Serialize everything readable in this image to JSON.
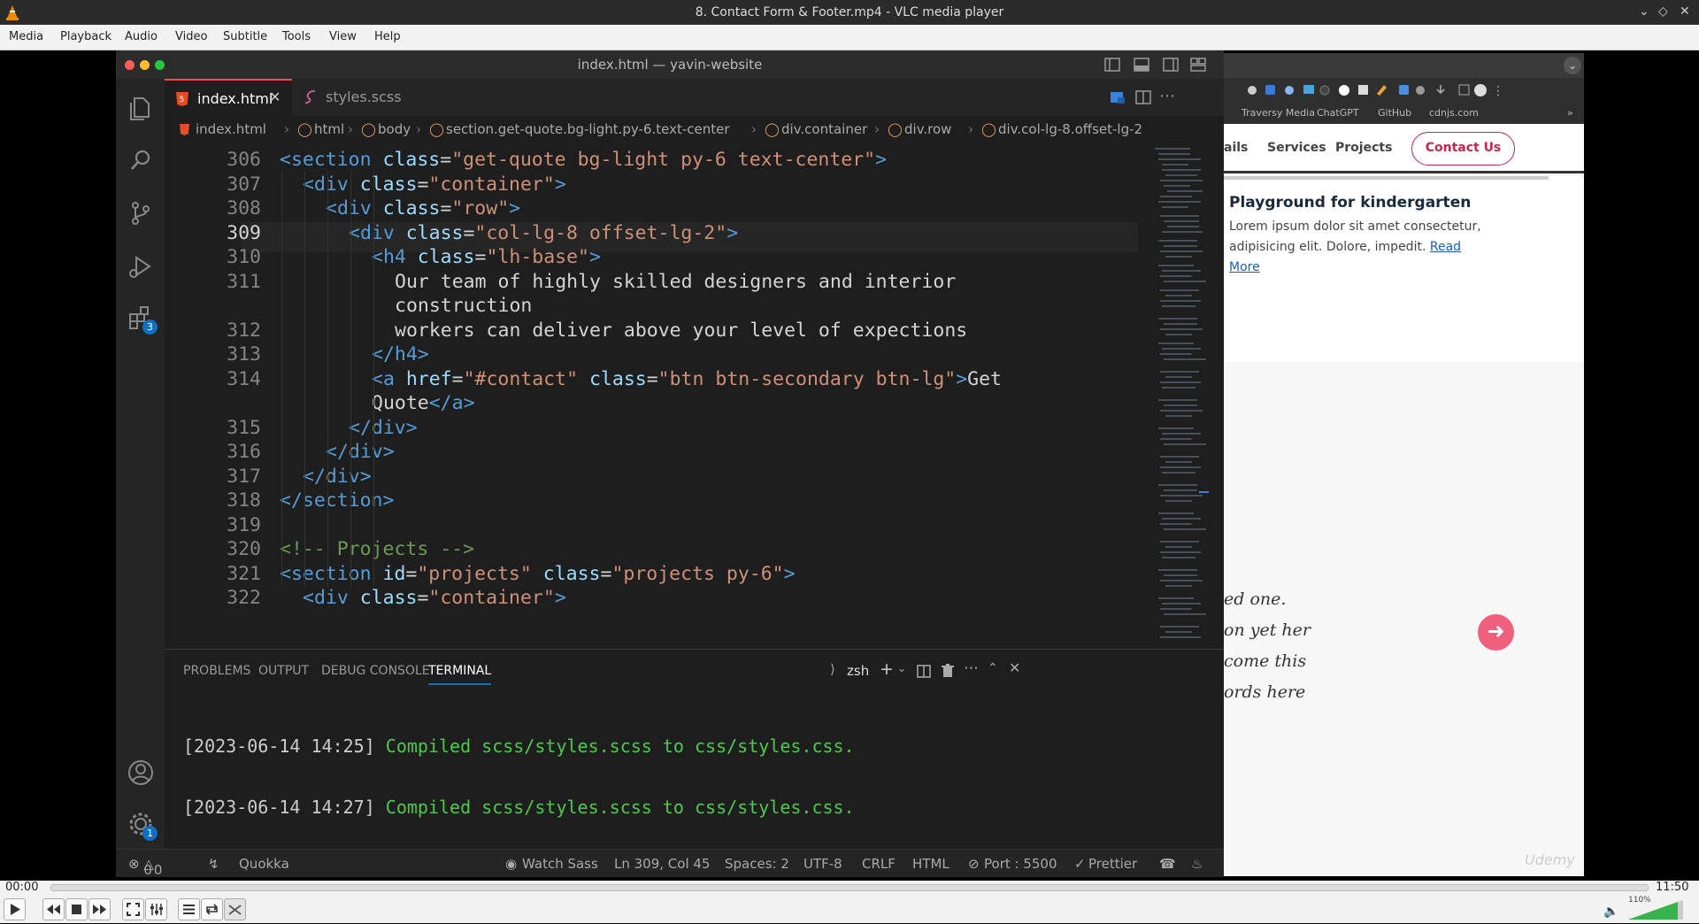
{
  "window": {
    "title": "8. Contact Form & Footer.mp4 - VLC media player"
  },
  "menu": [
    "Media",
    "Playback",
    "Audio",
    "Video",
    "Subtitle",
    "Tools",
    "View",
    "Help"
  ],
  "vscode": {
    "title": "index.html — yavin-website",
    "tabs": [
      {
        "label": "index.html",
        "active": true
      },
      {
        "label": "styles.scss",
        "active": false
      }
    ],
    "breadcrumb": [
      "index.html",
      "html",
      "body",
      "section.get-quote.bg-light.py-6.text-center",
      "div.container",
      "div.row",
      "div.col-lg-8.offset-lg-2"
    ],
    "extensions_badge": "3",
    "settings_badge": "1",
    "lines": [
      {
        "n": "306",
        "tokens": [
          [
            "tag",
            "<section "
          ],
          [
            "attr",
            "class"
          ],
          [
            "txt",
            "="
          ],
          [
            "str",
            "\"get-quote bg-light py-6 text-center\""
          ],
          [
            "tag",
            ">"
          ]
        ],
        "indent": 2
      },
      {
        "n": "307",
        "tokens": [
          [
            "tag",
            "<div "
          ],
          [
            "attr",
            "class"
          ],
          [
            "txt",
            "="
          ],
          [
            "str",
            "\"container\""
          ],
          [
            "tag",
            ">"
          ]
        ],
        "indent": 3
      },
      {
        "n": "308",
        "tokens": [
          [
            "tag",
            "<div "
          ],
          [
            "attr",
            "class"
          ],
          [
            "txt",
            "="
          ],
          [
            "str",
            "\"row\""
          ],
          [
            "tag",
            ">"
          ]
        ],
        "indent": 4
      },
      {
        "n": "309",
        "tokens": [
          [
            "tag",
            "<div "
          ],
          [
            "attr",
            "class"
          ],
          [
            "txt",
            "="
          ],
          [
            "str",
            "\"col-lg-8 offset-lg-2\""
          ],
          [
            "tag",
            ">"
          ]
        ],
        "indent": 5
      },
      {
        "n": "310",
        "tokens": [
          [
            "tag",
            "<h4 "
          ],
          [
            "attr",
            "class"
          ],
          [
            "txt",
            "="
          ],
          [
            "str",
            "\"lh-base\""
          ],
          [
            "tag",
            ">"
          ]
        ],
        "indent": 6
      },
      {
        "n": "311",
        "tokens": [
          [
            "txt",
            "Our team of highly skilled designers and interior"
          ]
        ],
        "indent": 7
      },
      {
        "n": "",
        "tokens": [
          [
            "txt",
            "construction"
          ]
        ],
        "indent": 7
      },
      {
        "n": "312",
        "tokens": [
          [
            "txt",
            "workers can deliver above your level of expections"
          ]
        ],
        "indent": 7
      },
      {
        "n": "313",
        "tokens": [
          [
            "tag",
            "</h4>"
          ]
        ],
        "indent": 6
      },
      {
        "n": "314",
        "tokens": [
          [
            "tag",
            "<a "
          ],
          [
            "attr",
            "href"
          ],
          [
            "txt",
            "="
          ],
          [
            "str",
            "\"#contact\""
          ],
          [
            "txt",
            " "
          ],
          [
            "attr",
            "class"
          ],
          [
            "txt",
            "="
          ],
          [
            "str",
            "\"btn btn-secondary btn-lg\""
          ],
          [
            "tag",
            ">"
          ],
          [
            "txt",
            "Get"
          ]
        ],
        "indent": 6
      },
      {
        "n": "",
        "tokens": [
          [
            "txt",
            "Quote"
          ],
          [
            "tag",
            "</a>"
          ]
        ],
        "indent": 6
      },
      {
        "n": "315",
        "tokens": [
          [
            "tag",
            "</div>"
          ]
        ],
        "indent": 5
      },
      {
        "n": "316",
        "tokens": [
          [
            "tag",
            "</div>"
          ]
        ],
        "indent": 4
      },
      {
        "n": "317",
        "tokens": [
          [
            "tag",
            "</div>"
          ]
        ],
        "indent": 3
      },
      {
        "n": "318",
        "tokens": [
          [
            "tag",
            "</section>"
          ]
        ],
        "indent": 2
      },
      {
        "n": "319",
        "tokens": [],
        "indent": 0
      },
      {
        "n": "320",
        "tokens": [
          [
            "com",
            "<!-- Projects -->"
          ]
        ],
        "indent": 2
      },
      {
        "n": "321",
        "tokens": [
          [
            "tag",
            "<section "
          ],
          [
            "attr",
            "id"
          ],
          [
            "txt",
            "="
          ],
          [
            "str",
            "\"projects\""
          ],
          [
            "txt",
            " "
          ],
          [
            "attr",
            "class"
          ],
          [
            "txt",
            "="
          ],
          [
            "str",
            "\"projects py-6\""
          ],
          [
            "tag",
            ">"
          ]
        ],
        "indent": 2
      },
      {
        "n": "322",
        "tokens": [
          [
            "tag",
            "<div "
          ],
          [
            "attr",
            "class"
          ],
          [
            "txt",
            "="
          ],
          [
            "str",
            "\"container\""
          ],
          [
            "tag",
            ">"
          ]
        ],
        "indent": 3
      }
    ],
    "panel": {
      "tabs": [
        "PROBLEMS",
        "OUTPUT",
        "DEBUG CONSOLE",
        "TERMINAL"
      ],
      "shell": "zsh",
      "terminal": [
        {
          "time": "[2023-06-14 14:25]",
          "msg": "Compiled scss/styles.scss to css/styles.css."
        },
        {
          "time": "[2023-06-14 14:27]",
          "msg": "Compiled scss/styles.scss to css/styles.css."
        }
      ]
    },
    "status": {
      "errors": "0",
      "warnings": "0",
      "quokka": "Quokka",
      "watch": "Watch Sass",
      "position": "Ln 309, Col 45",
      "spaces": "Spaces: 2",
      "encoding": "UTF-8",
      "eol": "CRLF",
      "lang": "HTML",
      "port": "Port : 5500",
      "prettier": "Prettier"
    }
  },
  "browser": {
    "bookmarks": [
      "Traversy Media",
      "ChatGPT",
      "GitHub",
      "cdnjs.com"
    ],
    "nav": [
      "ails",
      "Services",
      "Projects"
    ],
    "cta": "Contact Us",
    "card_title": "Playground for kindergarten",
    "card_text": "Lorem ipsum dolor sit amet consectetur, adipisicing elit. Dolore, impedit.",
    "card_link": "Read More",
    "quote_lines": [
      "ed one.",
      "on yet her",
      "come this",
      "ords here"
    ],
    "watermark": "Udemy"
  },
  "player": {
    "elapsed": "00:00",
    "total": "11:50",
    "volume": "110%",
    "progress": 0.0
  }
}
